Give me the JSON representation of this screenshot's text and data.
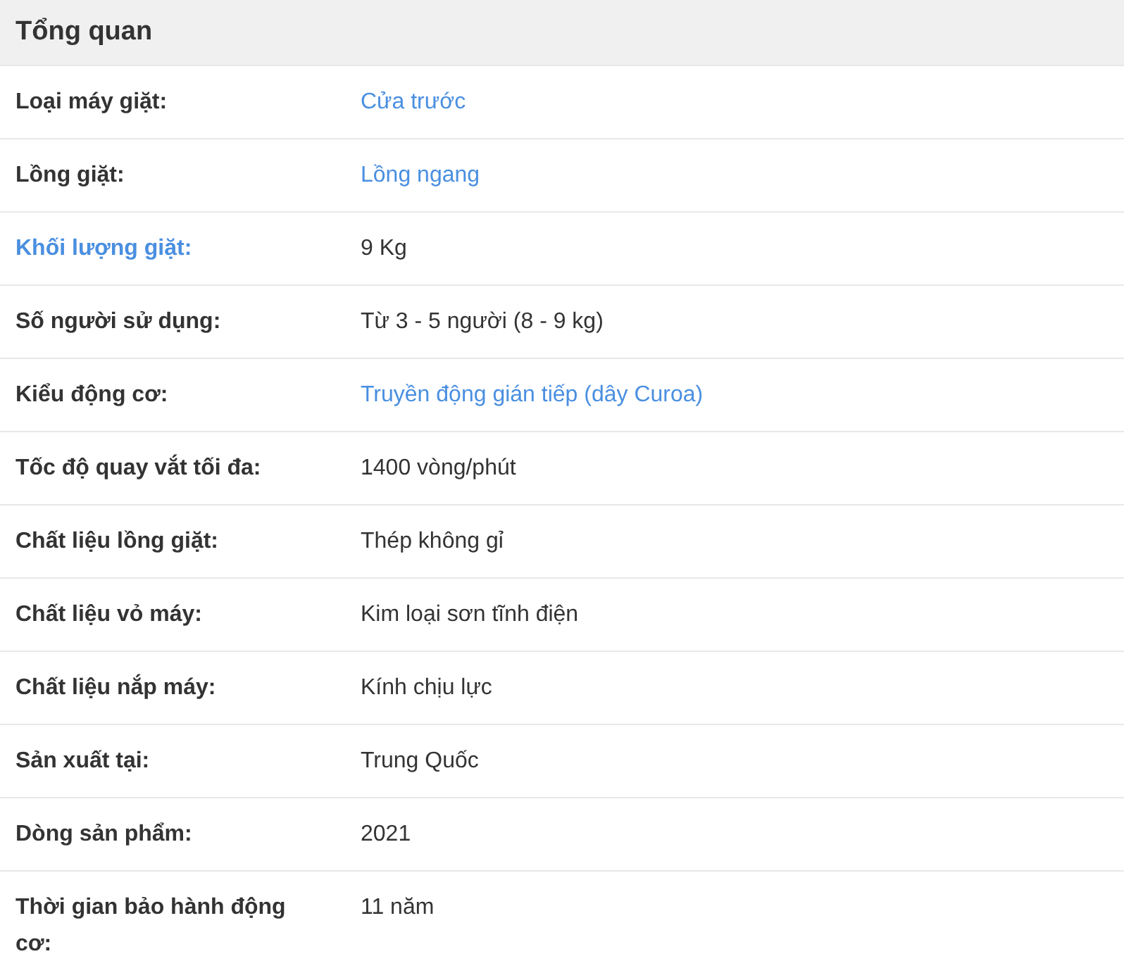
{
  "title": "Tổng quan",
  "rows": [
    {
      "label": "Loại máy giặt:",
      "label_link": false,
      "value": "Cửa trước",
      "value_link": true
    },
    {
      "label": "Lồng giặt:",
      "label_link": false,
      "value": "Lồng ngang",
      "value_link": true
    },
    {
      "label": "Khối lượng giặt:",
      "label_link": true,
      "value": "9 Kg",
      "value_link": false
    },
    {
      "label": "Số người sử dụng:",
      "label_link": false,
      "value": "Từ 3 - 5 người (8 - 9 kg)",
      "value_link": false
    },
    {
      "label": "Kiểu động cơ:",
      "label_link": false,
      "value": "Truyền động gián tiếp (dây Curoa)",
      "value_link": true
    },
    {
      "label": "Tốc độ quay vắt tối đa:",
      "label_link": false,
      "value": "1400 vòng/phút",
      "value_link": false
    },
    {
      "label": "Chất liệu lồng giặt:",
      "label_link": false,
      "value": "Thép không gỉ",
      "value_link": false
    },
    {
      "label": "Chất liệu vỏ máy:",
      "label_link": false,
      "value": "Kim loại sơn tĩnh điện",
      "value_link": false
    },
    {
      "label": "Chất liệu nắp máy:",
      "label_link": false,
      "value": "Kính chịu lực",
      "value_link": false
    },
    {
      "label": "Sản xuất tại:",
      "label_link": false,
      "value": "Trung Quốc",
      "value_link": false
    },
    {
      "label": "Dòng sản phẩm:",
      "label_link": false,
      "value": "2021",
      "value_link": false
    },
    {
      "label": "Thời gian bảo hành động cơ:",
      "label_link": false,
      "value": "11 năm",
      "value_link": false
    }
  ]
}
